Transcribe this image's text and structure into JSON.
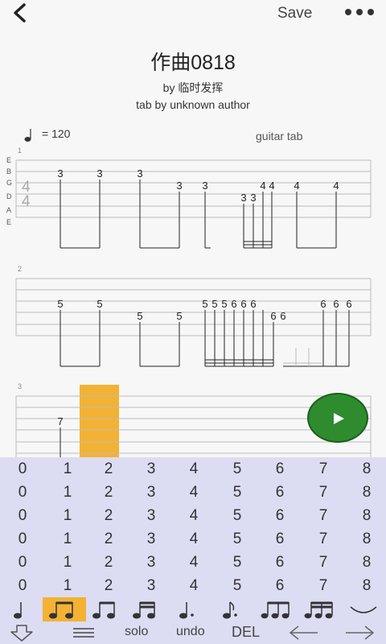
{
  "toolbar": {
    "save_label": "Save"
  },
  "song": {
    "title": "作曲0818",
    "author": "by 临时发挥",
    "tab_credit": "tab by unknown author",
    "tempo": "= 120",
    "instrument": "guitar tab"
  },
  "score": {
    "string_letters": [
      "E",
      "B",
      "G",
      "D",
      "A",
      "E"
    ],
    "time_signature": [
      "4",
      "4"
    ],
    "measure_numbers": [
      "1",
      "2",
      "3"
    ],
    "measure1_notes": [
      {
        "fret": "3",
        "string": 1
      },
      {
        "fret": "3",
        "string": 1
      },
      {
        "fret": "3",
        "string": 1
      },
      {
        "fret": "3",
        "string": 2
      },
      {
        "fret": "3",
        "string": 2
      },
      {
        "fret": "3",
        "string": 3
      },
      {
        "fret": "3",
        "string": 3
      },
      {
        "fret": "4",
        "string": 2
      },
      {
        "fret": "4",
        "string": 2
      },
      {
        "fret": "4",
        "string": 2
      },
      {
        "fret": "4",
        "string": 2
      }
    ],
    "measure2_notes": [
      {
        "fret": "5",
        "string": 2
      },
      {
        "fret": "5",
        "string": 2
      },
      {
        "fret": "5",
        "string": 3
      },
      {
        "fret": "5",
        "string": 3
      },
      {
        "fret": "5",
        "string": 2
      },
      {
        "fret": "5",
        "string": 2
      },
      {
        "fret": "5",
        "string": 2
      },
      {
        "fret": "6",
        "string": 2
      },
      {
        "fret": "6",
        "string": 2
      },
      {
        "fret": "6",
        "string": 2
      },
      {
        "fret": "6",
        "string": 3
      },
      {
        "fret": "6",
        "string": 3
      },
      {
        "fret": "6",
        "string": 2
      },
      {
        "fret": "6",
        "string": 2
      },
      {
        "fret": "6",
        "string": 2
      }
    ],
    "measure3_notes": [
      {
        "fret": "7",
        "string": 2
      }
    ]
  },
  "keypad": {
    "rows": [
      [
        "0",
        "1",
        "2",
        "3",
        "4",
        "5",
        "6",
        "7",
        "8"
      ],
      [
        "0",
        "1",
        "2",
        "3",
        "4",
        "5",
        "6",
        "7",
        "8"
      ],
      [
        "0",
        "1",
        "2",
        "3",
        "4",
        "5",
        "6",
        "7",
        "8"
      ],
      [
        "0",
        "1",
        "2",
        "3",
        "4",
        "5",
        "6",
        "7",
        "8"
      ],
      [
        "0",
        "1",
        "2",
        "3",
        "4",
        "5",
        "6",
        "7",
        "8"
      ],
      [
        "0",
        "1",
        "2",
        "3",
        "4",
        "5",
        "6",
        "7",
        "8"
      ]
    ]
  },
  "durations": [
    {
      "icon": "quarter-note-icon"
    },
    {
      "icon": "beamed-eighth-notes-icon",
      "selected": true
    },
    {
      "icon": "beamed-eighth-notes-icon"
    },
    {
      "icon": "beamed-sixteenth-notes-icon"
    },
    {
      "icon": "dotted-quarter-note-icon"
    },
    {
      "icon": "dotted-eighth-note-icon"
    },
    {
      "icon": "triplet-icon"
    },
    {
      "icon": "sixteenth-triplet-icon"
    },
    {
      "icon": "tie-icon"
    }
  ],
  "actions": {
    "solo": "solo",
    "undo": "undo",
    "delete": "DEL"
  },
  "colors": {
    "accent": "#f3b234",
    "play": "#2e8b2e",
    "keypad_bg": "#dcdcf3"
  }
}
